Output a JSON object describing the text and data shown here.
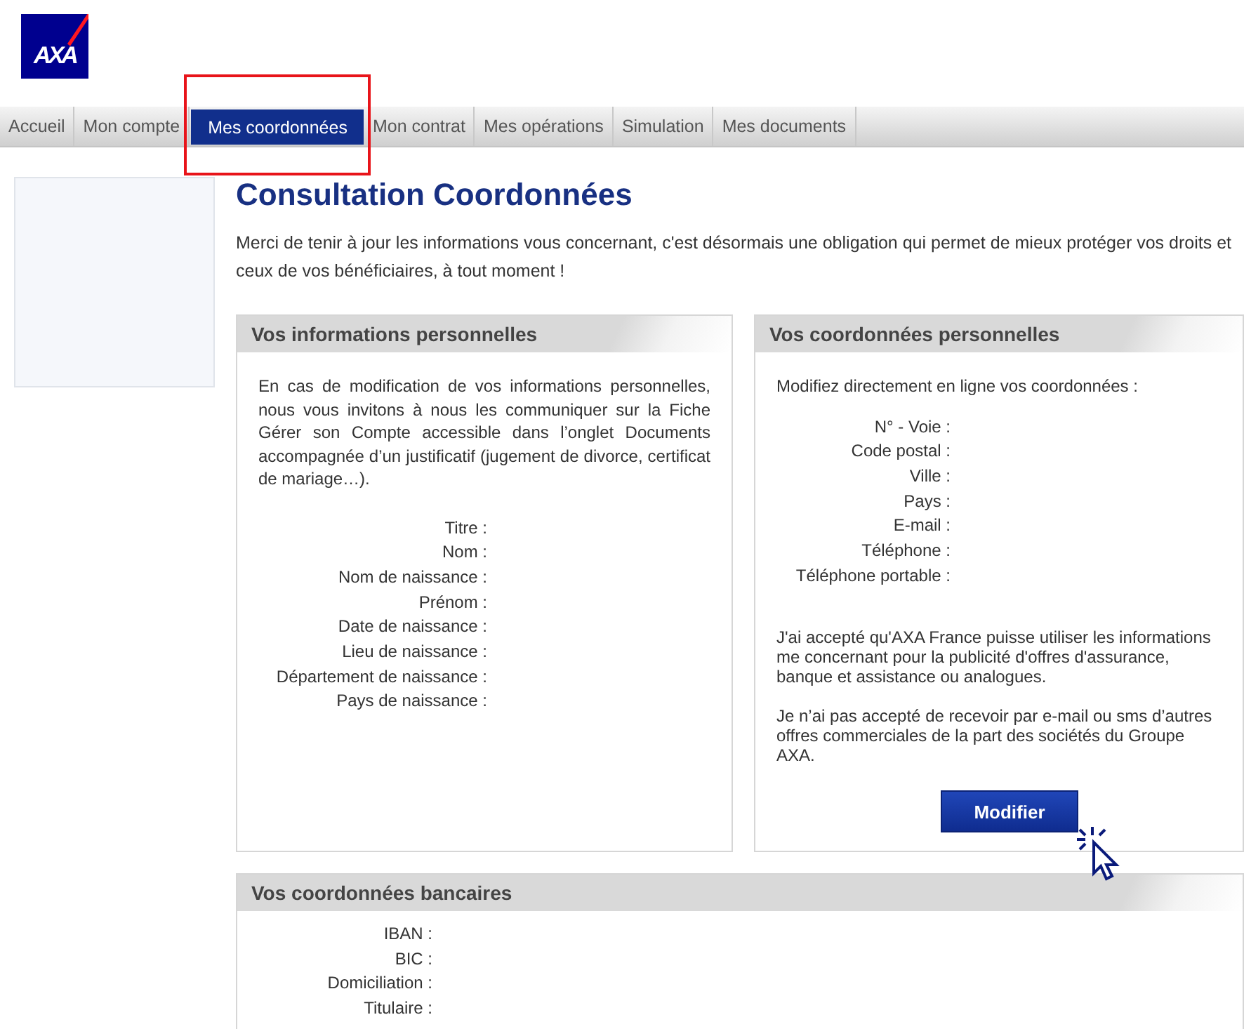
{
  "logo": {
    "text": "AXA"
  },
  "nav": [
    {
      "label": "Accueil",
      "selected": false,
      "highlighted": false
    },
    {
      "label": "Mon compte",
      "selected": false,
      "highlighted": false
    },
    {
      "label": "Mes coordonnées",
      "selected": true,
      "highlighted": true
    },
    {
      "label": "Mon contrat",
      "selected": false,
      "highlighted": false
    },
    {
      "label": "Mes opérations",
      "selected": false,
      "highlighted": false
    },
    {
      "label": "Simulation",
      "selected": false,
      "highlighted": false
    },
    {
      "label": "Mes documents",
      "selected": false,
      "highlighted": false
    }
  ],
  "title": "Consultation Coordonnées",
  "intro": "Merci de tenir à jour les informations vous concernant, c'est désormais une obligation qui permet de mieux protéger vos droits et ceux de vos bénéficiaires, à tout moment !",
  "panels": [
    {
      "title": "Vos informations personnelles",
      "text": "En cas de modification de vos informations personnelles, nous vous invitons à nous les communiquer sur la Fiche Gérer son Compte accessible dans l’onglet Documents accompagnée d’un justificatif (jugement de divorce, certificat de mariage…).",
      "fields": [
        "Titre :",
        "Nom :",
        "Nom de naissance :",
        "Prénom :",
        "Date de naissance :",
        "Lieu de naissance :",
        "Département de naissance :",
        "Pays de naissance :"
      ]
    },
    {
      "title": "Vos coordonnées personnelles",
      "text": "Modifiez directement en ligne vos coordonnées :",
      "fields": [
        "N° - Voie :",
        "Code postal :",
        "Ville :",
        "Pays :",
        "E-mail :",
        "Téléphone :",
        "Téléphone portable :"
      ],
      "notes": [
        "J'ai accepté qu'AXA France puisse utiliser les informations me concernant pour la publicité d'offres d'assurance, banque et assistance ou analogues.",
        "Je n’ai pas accepté de recevoir par e-mail ou sms d’autres offres commerciales de la part des sociétés du Groupe AXA."
      ],
      "button": "Modifier"
    },
    {
      "title": "Vos coordonnées bancaires",
      "fields": [
        "IBAN :",
        "BIC :",
        "Domiciliation :",
        "Titulaire :"
      ]
    }
  ]
}
